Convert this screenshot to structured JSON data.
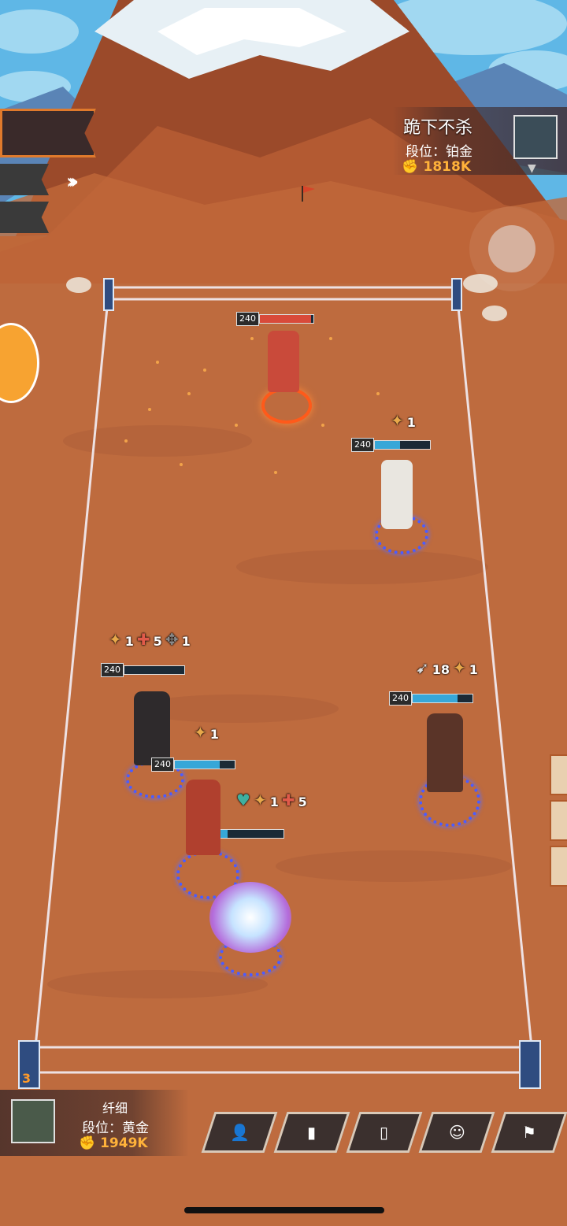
{
  "opponent": {
    "name": "跪下不杀",
    "rank": "段位：铂金",
    "power": "1818K"
  },
  "player": {
    "name": "纤细",
    "rank": "段位：黄金",
    "power": "1949K",
    "counter": "3"
  },
  "units": [
    {
      "id": "enemy-rabbit",
      "hp": "240",
      "fill": 0.95,
      "color": "#d94a3a"
    },
    {
      "id": "enemy-scientist",
      "hp": "240",
      "fill": 0.45,
      "color": "#37a7d8"
    },
    {
      "id": "ally-nun",
      "hp": "240",
      "fill": 0.0,
      "color": "#37a7d8"
    },
    {
      "id": "ally-nun-2",
      "hp": "240",
      "fill": 0.75,
      "color": "#37a7d8"
    },
    {
      "id": "ally-archer",
      "hp": "240",
      "fill": 0.75,
      "color": "#37a7d8"
    },
    {
      "id": "ally-rabbit",
      "hp": "240",
      "fill": 0.15,
      "color": "#37a7d8"
    }
  ],
  "buffs": {
    "scientist": [
      "1"
    ],
    "nun_a": [
      "1",
      "5",
      "1"
    ],
    "nun_b": [
      "1"
    ],
    "archer": [
      "18",
      "1"
    ],
    "rabbit": [
      "1",
      "5"
    ]
  },
  "buttons": [
    {
      "icon": "person-list-icon",
      "glyph": "👤"
    },
    {
      "icon": "stats-icon",
      "glyph": "▮"
    },
    {
      "icon": "spray-icon",
      "glyph": "▯"
    },
    {
      "icon": "emoji-icon",
      "glyph": "☺"
    },
    {
      "icon": "flag-icon",
      "glyph": "⚑"
    }
  ]
}
